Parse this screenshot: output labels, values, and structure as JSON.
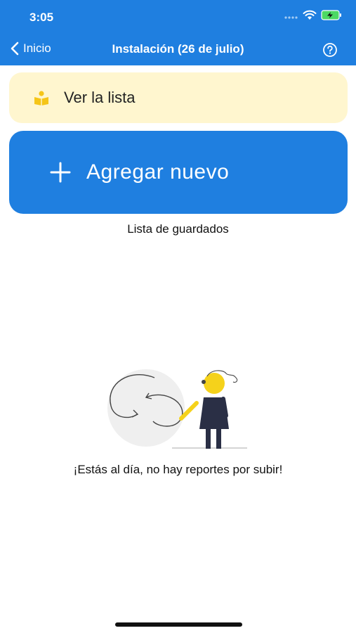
{
  "status": {
    "time": "3:05"
  },
  "nav": {
    "back_label": "Inicio",
    "title": "Instalación (26 de julio)"
  },
  "list_card": {
    "label": "Ver la lista"
  },
  "add_card": {
    "label": "Agregar nuevo"
  },
  "saved": {
    "title": "Lista de guardados"
  },
  "empty_state": {
    "message": "¡Estás al día, no hay reportes por subir!"
  },
  "colors": {
    "accent": "#1f7fe0",
    "list_card_bg": "#fff6cf",
    "illustration_yellow": "#f5d21b"
  }
}
